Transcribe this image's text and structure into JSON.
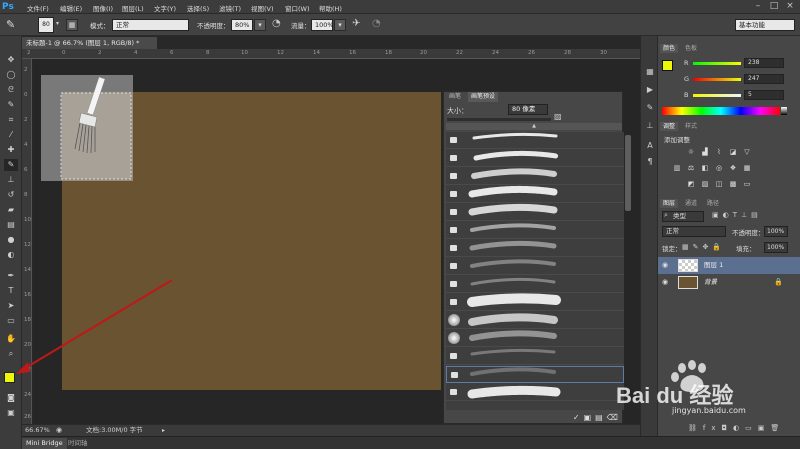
{
  "menubar": {
    "app_icon": "Ps",
    "items": [
      "文件(F)",
      "编辑(E)",
      "图像(I)",
      "图层(L)",
      "文字(Y)",
      "选择(S)",
      "滤镜(T)",
      "视图(V)",
      "窗口(W)",
      "帮助(H)"
    ]
  },
  "options": {
    "brush_size": "80",
    "mode_label": "模式：",
    "mode_value": "正常",
    "opacity_label": "不透明度：",
    "opacity_value": "80%",
    "flow_label": "流量：",
    "flow_value": "100%",
    "workspace": "基本功能"
  },
  "document": {
    "tab_title": "未标题-1 @ 66.7% (图层 1, RGB/8) *",
    "zoom": "66.67%",
    "doc_info": "文档:3.00M/0 字节",
    "canvas_color": "#695330"
  },
  "rulers": {
    "top": [
      "2",
      "0",
      "2",
      "4",
      "6",
      "8",
      "10",
      "12",
      "14",
      "16",
      "18",
      "20",
      "22",
      "24",
      "26",
      "28",
      "30"
    ],
    "left": [
      "2",
      "0",
      "2",
      "4",
      "6",
      "8",
      "10",
      "12",
      "14",
      "16",
      "18",
      "20",
      "22",
      "24",
      "26"
    ]
  },
  "brush_panel": {
    "tabs": [
      "画笔",
      "画笔预设"
    ],
    "size_label": "大小：",
    "size_value": "80 像素"
  },
  "color_panel": {
    "tabs": [
      "颜色",
      "色板"
    ],
    "r_label": "R",
    "r_value": "238",
    "g_label": "G",
    "g_value": "247",
    "b_label": "B",
    "b_value": "5",
    "foreground": "#eef705"
  },
  "adjust_panel": {
    "tabs": [
      "调整",
      "样式"
    ],
    "title": "添加调整"
  },
  "layers_panel": {
    "tabs": [
      "图层",
      "通道",
      "路径"
    ],
    "filter": "类型",
    "blend_mode": "正常",
    "opacity_label": "不透明度：",
    "opacity_value": "100%",
    "lock_label": "锁定：",
    "fill_label": "填充：",
    "fill_value": "100%",
    "layers": [
      {
        "name": "图层 1",
        "selected": true
      },
      {
        "name": "背景",
        "selected": false
      }
    ]
  },
  "bottom_tabs": [
    "Mini Bridge",
    "时间轴"
  ],
  "watermark": {
    "brand": "Bai du 经验",
    "url": "jingyan.baidu.com"
  }
}
